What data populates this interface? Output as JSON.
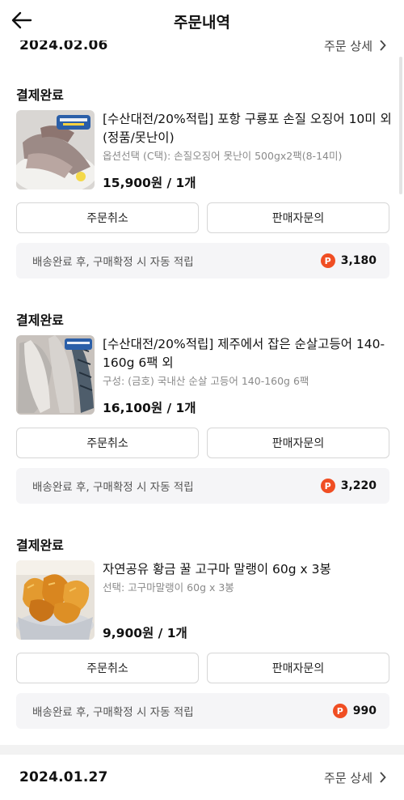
{
  "header": {
    "title": "주문내역",
    "back_icon": "arrow-left-icon"
  },
  "groups": [
    {
      "date": "2024.02.06",
      "detail_label": "주문 상세"
    },
    {
      "date": "2024.01.27",
      "detail_label": "주문 상세"
    }
  ],
  "orders": [
    {
      "status": "결제완료",
      "name": "[수산대전/20%적립] 포항 구룡포 손질 오징어 10미 외 (정품/못난이)",
      "option": "옵션선택 (C택): 손질오징어 못난이 500gx2팩(8-14미)",
      "price": "15,900원 / 1개",
      "cancel_label": "주문취소",
      "inquiry_label": "판매자문의",
      "reward_text": "배송완료 후, 구매확정 시 자동 적립",
      "points": "3,180",
      "thumb_icon": "squid-product-image"
    },
    {
      "status": "결제완료",
      "name": "[수산대전/20%적립] 제주에서 잡은 순살고등어 140-160g 6팩 외",
      "option": "구성: (금호) 국내산 순살 고등어 140-160g 6팩",
      "price": "16,100원 / 1개",
      "cancel_label": "주문취소",
      "inquiry_label": "판매자문의",
      "reward_text": "배송완료 후, 구매확정 시 자동 적립",
      "points": "3,220",
      "thumb_icon": "mackerel-product-image"
    },
    {
      "status": "결제완료",
      "name": "자연공유 황금 꿀 고구마 말랭이 60g x 3봉",
      "option": "선택: 고구마말랭이 60g x 3봉",
      "price": "9,900원 / 1개",
      "cancel_label": "주문취소",
      "inquiry_label": "판매자문의",
      "reward_text": "배송완료 후, 구매확정 시 자동 적립",
      "points": "990",
      "thumb_icon": "sweet-potato-product-image"
    }
  ],
  "points_badge": "P",
  "colors": {
    "accent": "#f04e23",
    "reward_bg": "#f5f5f7",
    "border": "#d6d6d6"
  }
}
